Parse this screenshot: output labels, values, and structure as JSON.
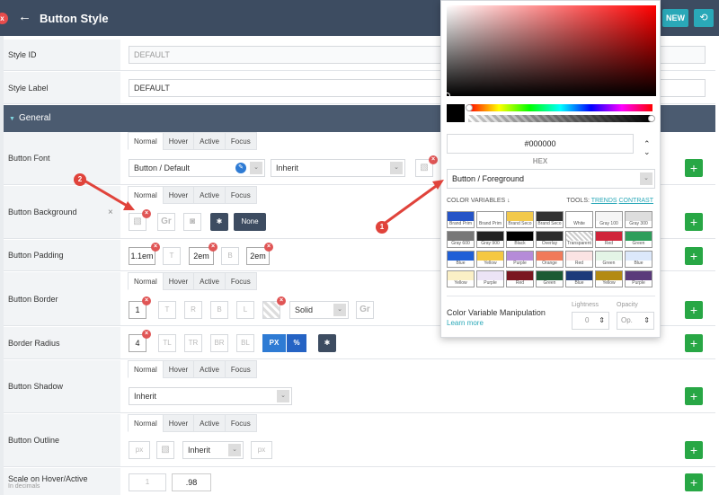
{
  "header": {
    "close": "x",
    "back_icon": "←",
    "title": "Button Style",
    "new_label": "NEW",
    "history_icon": "⟲"
  },
  "style_id": {
    "label": "Style ID",
    "value": "DEFAULT"
  },
  "style_label": {
    "label": "Style Label",
    "value": "DEFAULT"
  },
  "section": {
    "title": "General"
  },
  "tabs": [
    "Normal",
    "Hover",
    "Active",
    "Focus"
  ],
  "button_font": {
    "label": "Button Font",
    "font_value": "Button / Default",
    "inherit_value": "Inherit"
  },
  "button_background": {
    "label": "Button Background",
    "gr_label": "Gr",
    "none_label": "None"
  },
  "button_padding": {
    "label": "Button Padding",
    "top": "1.1em",
    "right": "T",
    "bottom": "2em",
    "left_ph": "B",
    "left": "2em"
  },
  "button_border": {
    "label": "Button Border",
    "width": "1",
    "t": "T",
    "r": "R",
    "b": "B",
    "l": "L",
    "style": "Solid",
    "gr_label": "Gr"
  },
  "border_radius": {
    "label": "Border Radius",
    "value": "4",
    "tl": "TL",
    "tr": "TR",
    "br": "BR",
    "bl": "BL",
    "px": "PX",
    "pct": "%"
  },
  "button_shadow": {
    "label": "Button Shadow",
    "value": "Inherit"
  },
  "button_outline": {
    "label": "Button Outline",
    "px1": "px",
    "style": "Inherit",
    "px2": "px"
  },
  "scale": {
    "label": "Scale on Hover/Active",
    "sublabel": "In decimals",
    "ph": "1",
    "value": ".98"
  },
  "picker": {
    "hex": "#000000",
    "hex_label": "HEX",
    "variable": "Button / Foreground",
    "cv_label": "COLOR VARIABLES ↓",
    "tools_label": "TOOLS:",
    "trends": "TRENDS",
    "contrast": "CONTRAST",
    "cvm_title": "Color Variable Manipulation",
    "learn_more": "Learn more",
    "lightness_label": "Lightness",
    "lightness_value": "0",
    "opacity_label": "Opacity",
    "opacity_value": "Op."
  },
  "palette": [
    {
      "name": "Brand Prim",
      "color": "#2554c7"
    },
    {
      "name": "Brand Prim",
      "color": "#ffffff"
    },
    {
      "name": "Brand Seco",
      "color": "#f2c94c"
    },
    {
      "name": "Brand Seco",
      "color": "#333333"
    },
    {
      "name": "White",
      "color": "#ffffff"
    },
    {
      "name": "Gray 100",
      "color": "#f5f5f5"
    },
    {
      "name": "Gray 300",
      "color": "#dddddd"
    },
    {
      "name": "Gray 600",
      "color": "#777777"
    },
    {
      "name": "Gray 900",
      "color": "#222222"
    },
    {
      "name": "Black",
      "color": "#000000"
    },
    {
      "name": "Overlay",
      "color": "#2b2b2b"
    },
    {
      "name": "Transparent",
      "color": "transparent"
    },
    {
      "name": "Red",
      "color": "#d0243a"
    },
    {
      "name": "Green",
      "color": "#2e9e5b"
    },
    {
      "name": "Blue",
      "color": "#1f5fd6"
    },
    {
      "name": "Yellow",
      "color": "#f5c842"
    },
    {
      "name": "Purple",
      "color": "#b58bd8"
    },
    {
      "name": "Orange",
      "color": "#f07a5a"
    },
    {
      "name": "Red",
      "color": "#fbe3e3"
    },
    {
      "name": "Green",
      "color": "#e3f4e6"
    },
    {
      "name": "Blue",
      "color": "#dce8fb"
    },
    {
      "name": "Yellow",
      "color": "#fbf0c6"
    },
    {
      "name": "Purple",
      "color": "#ece4f6"
    },
    {
      "name": "Red",
      "color": "#7a1620"
    },
    {
      "name": "Green",
      "color": "#1c5a34"
    },
    {
      "name": "Blue",
      "color": "#1d3a7a"
    },
    {
      "name": "Yellow",
      "color": "#b38a12"
    },
    {
      "name": "Purple",
      "color": "#5a3a7a"
    }
  ],
  "annotations": {
    "one": "1",
    "two": "2"
  },
  "colors": {
    "header": "#3d4c61",
    "accent": "#2aa8b8",
    "add": "#28a745",
    "annotation": "#e0433b"
  }
}
